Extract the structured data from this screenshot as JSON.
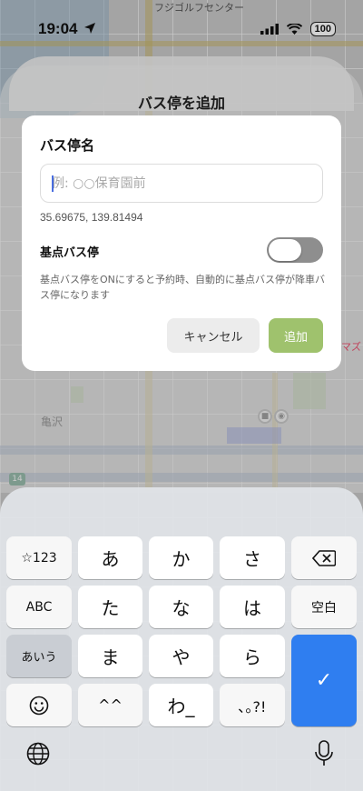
{
  "status_bar": {
    "time": "19:04",
    "battery": "100",
    "map_top_label": "フジゴルフセンター"
  },
  "map": {
    "area_label": "亀沢",
    "route_number": "14",
    "side_label": "マズ"
  },
  "sheet": {
    "title": "バス停を追加"
  },
  "dialog": {
    "title": "バス停名",
    "name_placeholder": "例: ○○保育園前",
    "coordinates": "35.69675, 139.81494",
    "base_stop_label": "基点バス停",
    "base_stop_on": false,
    "help_text": "基点バス停をONにすると予約時、自動的に基点バス停が降車バス停になります",
    "cancel_label": "キャンセル",
    "add_label": "追加"
  },
  "keyboard": {
    "row1": [
      "☆123",
      "あ",
      "か",
      "さ"
    ],
    "row2": [
      "ABC",
      "た",
      "な",
      "は",
      "空白"
    ],
    "row3": [
      "あいう",
      "ま",
      "や",
      "ら"
    ],
    "row4": [
      "^^",
      "わ_",
      "､｡?!"
    ],
    "enter_symbol": "✓"
  },
  "colors": {
    "add_button": "#9fc26d",
    "enter_key": "#2f7ef0",
    "toggle_off": "#8e8e8e"
  }
}
